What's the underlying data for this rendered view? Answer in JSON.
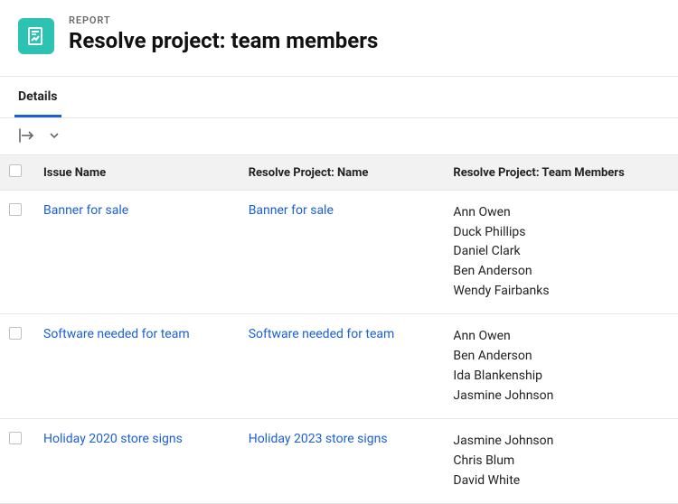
{
  "header": {
    "eyebrow": "REPORT",
    "title": "Resolve project: team members"
  },
  "tabs": [
    {
      "label": "Details",
      "active": true
    }
  ],
  "table": {
    "columns": {
      "issue_name": "Issue Name",
      "resolve_name": "Resolve Project: Name",
      "team_members": "Resolve Project: Team Members"
    },
    "rows": [
      {
        "issue_name": "Banner for sale",
        "resolve_name": "Banner for sale",
        "members": [
          "Ann Owen",
          "Duck Phillips",
          "Daniel Clark",
          "Ben Anderson",
          "Wendy Fairbanks"
        ]
      },
      {
        "issue_name": "Software needed for team",
        "resolve_name": "Software needed for team",
        "members": [
          "Ann Owen",
          "Ben Anderson",
          "Ida Blankenship",
          "Jasmine Johnson"
        ]
      },
      {
        "issue_name": "Holiday 2020 store signs",
        "resolve_name": "Holiday 2023 store signs",
        "members": [
          "Jasmine Johnson",
          "Chris Blum",
          "David White"
        ]
      }
    ]
  }
}
